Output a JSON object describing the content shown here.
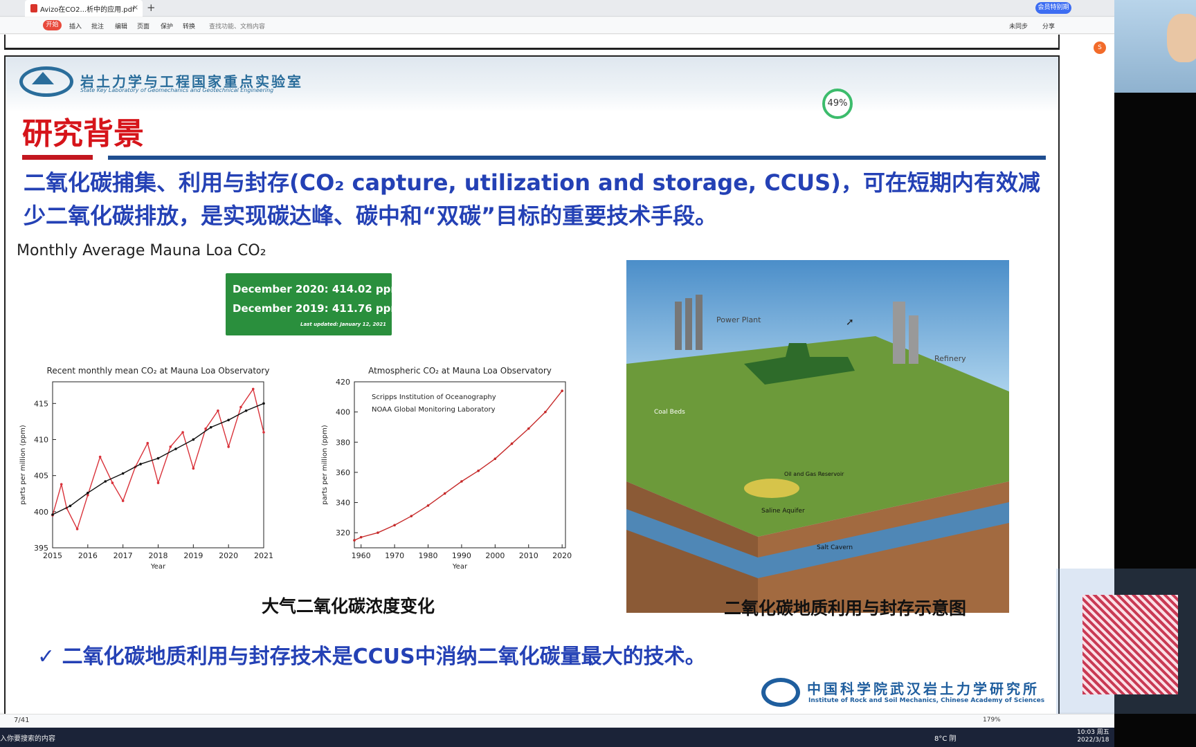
{
  "tab": {
    "title": "Avizo在CO2...析中的应用.pdf",
    "close_label": "×",
    "new_tab": "+",
    "vip_label": "会员特别期"
  },
  "toolbar": {
    "start": "开始",
    "items": [
      "插入",
      "批注",
      "编辑",
      "页面",
      "保护",
      "转换"
    ],
    "search_placeholder": "查找功能、文档内容",
    "sync": "未同步",
    "share": "分享"
  },
  "slide": {
    "lab_name_cn": "岩土力学与工程国家重点实验室",
    "lab_name_en": "State Key Laboratory of Geomechanics and Geotechnical Engineering",
    "gauge_value": "49%",
    "title": "研究背景",
    "paragraph": "二氧化碳捕集、利用与封存(CO₂ capture, utilization and storage, CCUS)，可在短期内有效减少二氧化碳排放，是实现碳达峰、碳中和“双碳”目标的重要技术手段。",
    "co2_label": "Monthly Average Mauna Loa CO₂",
    "green_box": {
      "line1": "December 2020:    414.02 ppm",
      "line2": "December 2019:    411.76 ppm",
      "updated": "Last updated: January 12, 2021"
    },
    "caption_left": "大气二氧化碳浓度变化",
    "caption_right": "二氧化碳地质利用与封存示意图",
    "bullet": "✓  二氧化碳地质利用与封存技术是CCUS中消纳二氧化碳量最大的技术。",
    "inst_cn": "中国科学院武汉岩土力学研究所",
    "inst_en": "Institute of Rock and Soil Mechanics, Chinese Academy of Sciences",
    "illus_labels": [
      "Power Plant",
      "Refinery",
      "Coal Beds",
      "Oil and Gas Reservoir",
      "Saline Aquifer",
      "Salt Cavern"
    ]
  },
  "statusbar": {
    "page": "7/41",
    "zoom": "179%"
  },
  "taskbar": {
    "search_text": "入你要搜索的内容",
    "time": "10:03 周五",
    "date": "2022/3/18",
    "weather": "8°C 阴"
  },
  "chart_data": [
    {
      "type": "line",
      "title": "Recent monthly mean CO₂ at Mauna Loa Observatory",
      "xlabel": "Year",
      "ylabel": "parts per million (ppm)",
      "xlim": [
        2015,
        2021
      ],
      "ylim": [
        395,
        418
      ],
      "x_ticks": [
        "2015",
        "2016",
        "2017",
        "2018",
        "2019",
        "2020",
        "2021"
      ],
      "y_ticks": [
        "395",
        "400",
        "405",
        "410",
        "415"
      ],
      "series": [
        {
          "color": "#d9323a",
          "x": [
            2015.0,
            2015.25,
            2015.4,
            2015.7,
            2016.0,
            2016.35,
            2016.7,
            2017.0,
            2017.35,
            2017.7,
            2018.0,
            2018.35,
            2018.7,
            2019.0,
            2019.35,
            2019.7,
            2020.0,
            2020.35,
            2020.7,
            2021.0
          ],
          "y": [
            399.5,
            403.8,
            400.5,
            397.6,
            402.3,
            407.6,
            404.0,
            401.5,
            406.2,
            409.5,
            404.0,
            409.0,
            411.0,
            406.0,
            411.5,
            414.0,
            409.0,
            414.5,
            417.0,
            411.0
          ]
        },
        {
          "color": "#111111",
          "x": [
            2015.0,
            2015.5,
            2016.0,
            2016.5,
            2017.0,
            2017.5,
            2018.0,
            2018.5,
            2019.0,
            2019.5,
            2020.0,
            2020.5,
            2021.0
          ],
          "y": [
            399.6,
            400.8,
            402.6,
            404.2,
            405.3,
            406.6,
            407.4,
            408.7,
            410.0,
            411.7,
            412.7,
            414.0,
            415.0
          ]
        }
      ]
    },
    {
      "type": "line",
      "title": "Atmospheric CO₂ at Mauna Loa Observatory",
      "xlabel": "Year",
      "ylabel": "parts per million (ppm)",
      "xlim": [
        1958,
        2021
      ],
      "ylim": [
        310,
        420
      ],
      "x_ticks": [
        "1960",
        "1970",
        "1980",
        "1990",
        "2000",
        "2010",
        "2020"
      ],
      "y_ticks": [
        "320",
        "340",
        "360",
        "380",
        "400",
        "420"
      ],
      "annotations": [
        "Scripps Institution of Oceanography",
        "NOAA Global Monitoring Laboratory"
      ],
      "series": [
        {
          "color": "#c62a2a",
          "x": [
            1958,
            1960,
            1965,
            1970,
            1975,
            1980,
            1985,
            1990,
            1995,
            2000,
            2005,
            2010,
            2015,
            2020
          ],
          "y": [
            315,
            317,
            320,
            325,
            331,
            338,
            346,
            354,
            361,
            369,
            379,
            389,
            400,
            414
          ]
        }
      ]
    }
  ]
}
